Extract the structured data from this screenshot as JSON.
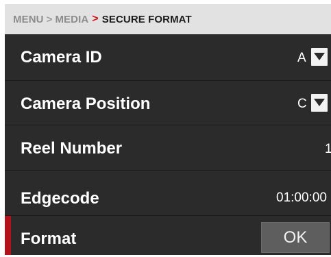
{
  "breadcrumb": {
    "items": [
      "MENU",
      "MEDIA"
    ],
    "separator": ">",
    "current_separator": ">",
    "current": "SECURE FORMAT"
  },
  "rows": {
    "camera_id": {
      "label": "Camera ID",
      "value": "A",
      "control": "chevron-down-icon"
    },
    "camera_position": {
      "label": "Camera Position",
      "value": "C",
      "control": "chevron-down-icon"
    },
    "reel_number": {
      "label": "Reel Number",
      "value": "1"
    },
    "edgecode": {
      "label": "Edgecode",
      "value": "01:00:00"
    },
    "format": {
      "label": "Format",
      "button_label": "OK"
    }
  },
  "colors": {
    "background": "#2b2b2b",
    "breadcrumb_background": "#e2e2e2",
    "accent_red": "#d4121c",
    "selected_marker": "#b3121a",
    "button": "#5e5e5e"
  }
}
